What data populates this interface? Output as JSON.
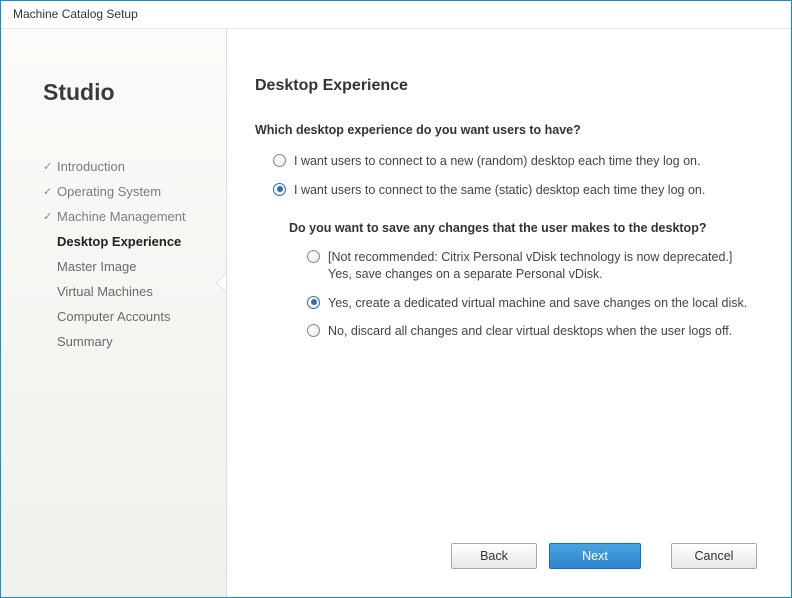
{
  "window": {
    "title": "Machine Catalog Setup"
  },
  "sidebar": {
    "brand": "Studio",
    "items": [
      {
        "label": "Introduction",
        "state": "done"
      },
      {
        "label": "Operating System",
        "state": "done"
      },
      {
        "label": "Machine Management",
        "state": "done"
      },
      {
        "label": "Desktop Experience",
        "state": "current"
      },
      {
        "label": "Master Image",
        "state": "pending"
      },
      {
        "label": "Virtual Machines",
        "state": "pending"
      },
      {
        "label": "Computer Accounts",
        "state": "pending"
      },
      {
        "label": "Summary",
        "state": "pending"
      }
    ]
  },
  "main": {
    "heading": "Desktop Experience",
    "q1": "Which desktop experience do you want users to have?",
    "opt_random": "I want users to connect to a new (random) desktop each time they log on.",
    "opt_static": "I want users to connect to the same (static) desktop each time they log on.",
    "q2": "Do you want to save any changes that the user makes to the desktop?",
    "opt_pvd": "[Not recommended: Citrix Personal vDisk technology is now deprecated.] Yes, save changes on a separate Personal vDisk.",
    "opt_dedicated": "Yes, create a dedicated virtual machine and save changes on the local disk.",
    "opt_discard": "No, discard all changes and clear virtual desktops when the user logs off.",
    "selection1": "static",
    "selection2": "dedicated"
  },
  "footer": {
    "back": "Back",
    "next": "Next",
    "cancel": "Cancel"
  }
}
